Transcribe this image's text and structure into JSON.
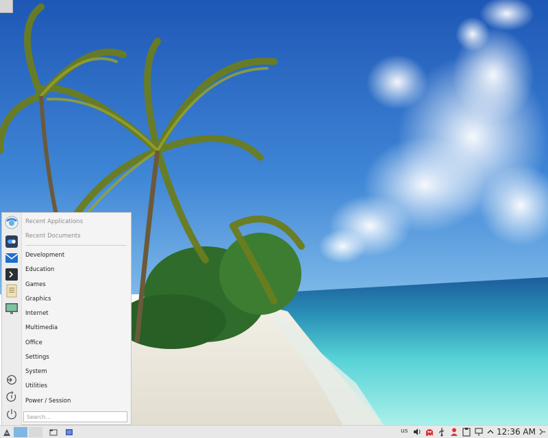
{
  "menu": {
    "items": [
      {
        "label": "Recent Applications"
      },
      {
        "label": "Recent Documents"
      },
      {
        "label": "Development"
      },
      {
        "label": "Education"
      },
      {
        "label": "Games"
      },
      {
        "label": "Graphics"
      },
      {
        "label": "Internet"
      },
      {
        "label": "Multimedia"
      },
      {
        "label": "Office"
      },
      {
        "label": "Settings"
      },
      {
        "label": "System"
      },
      {
        "label": "Utilities"
      },
      {
        "label": "Power / Session"
      }
    ],
    "search_placeholder": "Search..."
  },
  "favorites": [
    "web-browser-icon",
    "settings-toggle-icon",
    "mail-client-icon",
    "terminal-icon",
    "text-editor-icon",
    "monitor-app-icon"
  ],
  "session": [
    "logout-icon",
    "restart-icon",
    "shutdown-icon"
  ],
  "taskbar": {
    "keyboard_layout": "us",
    "clock": "12:36 AM"
  },
  "colors": {
    "menu_bg": "#f4f4f4",
    "taskbar_bg": "#e8e8e8",
    "workspace_active": "#7fb6e3",
    "sky": "#2f6fc4",
    "sea": "#5fd6d6"
  }
}
